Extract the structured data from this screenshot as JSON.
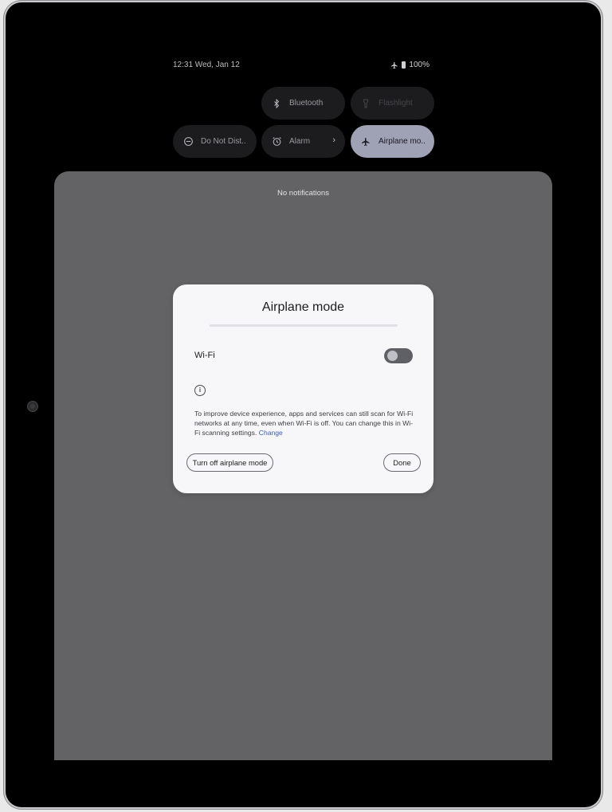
{
  "status_bar": {
    "time_date": "12:31 Wed, Jan 12",
    "battery": "100%"
  },
  "quick_tiles": [
    {
      "label": "Bluetooth",
      "icon": "bluetooth-icon",
      "state": "off"
    },
    {
      "label": "Flashlight",
      "icon": "flashlight-icon",
      "state": "disabled"
    },
    {
      "label": "Do Not Dist..",
      "icon": "do-not-disturb-icon",
      "state": "off"
    },
    {
      "label": "Alarm",
      "icon": "alarm-icon",
      "state": "off",
      "chevron": "›"
    },
    {
      "label": "Airplane mo..",
      "icon": "airplane-icon",
      "state": "on"
    }
  ],
  "shade": {
    "empty_text": "No notifications"
  },
  "dialog": {
    "title": "Airplane mode",
    "wifi_label": "Wi-Fi",
    "wifi_enabled": false,
    "info_text": "To improve device experience, apps and services can still scan for Wi-Fi networks at any time, even when Wi-Fi is off. You can change this in Wi-Fi scanning settings.",
    "info_link": "Change",
    "turn_off_label": "Turn off airplane mode",
    "done_label": "Done"
  },
  "colors": {
    "active_tile": "#9fa1b4",
    "shade": "#636365",
    "dialog_bg": "#f7f7f9",
    "link": "#3b5bb5"
  }
}
